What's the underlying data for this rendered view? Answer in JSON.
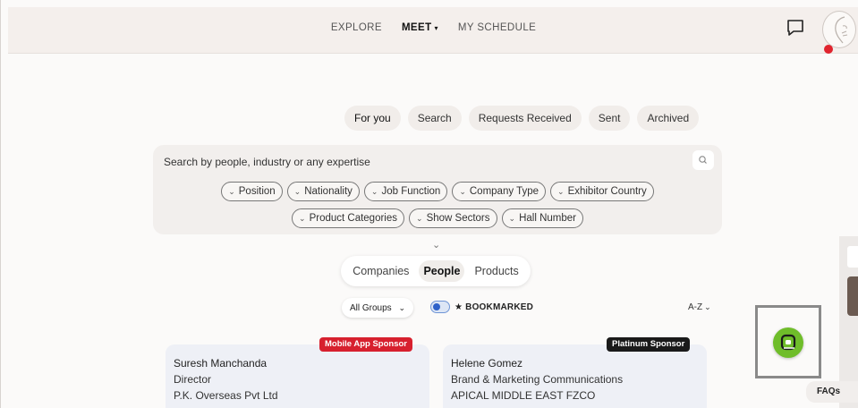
{
  "nav": {
    "items": [
      "EXPLORE",
      "MEET",
      "MY SCHEDULE"
    ],
    "active": "MEET",
    "caret": "▾"
  },
  "header_icons": {
    "chat": "chat-bubble-icon",
    "avatar": "user-avatar",
    "notification_color": "#e0242e"
  },
  "tabs": [
    "For you",
    "Search",
    "Requests Received",
    "Sent",
    "Archived"
  ],
  "search": {
    "placeholder": "Search by people, industry or any expertise",
    "filters_row1": [
      "Position",
      "Nationality",
      "Job Function",
      "Company Type",
      "Exhibitor Country"
    ],
    "filters_row2": [
      "Product Categories",
      "Show Sectors",
      "Hall Number"
    ]
  },
  "segment": {
    "items": [
      "Companies",
      "People",
      "Products"
    ],
    "active": "People"
  },
  "controls": {
    "groups_label": "All Groups",
    "bookmarked_label": "★ BOOKMARKED",
    "sort_label": "A-Z"
  },
  "cards": [
    {
      "badge": "Mobile App Sponsor",
      "badge_color": "#d7202e",
      "name": "Suresh Manchanda",
      "role": "Director",
      "company": "P.K. Overseas Pvt Ltd"
    },
    {
      "badge": "Platinum Sponsor",
      "badge_color": "#1a1a1a",
      "name": "Helene Gomez",
      "role": "Brand & Marketing Communications",
      "company": "APICAL MIDDLE EAST FZCO"
    }
  ],
  "faq_label": "FAQs",
  "accent_colors": {
    "widget": "#6fbd2a",
    "toggle": "#2f62c9"
  }
}
